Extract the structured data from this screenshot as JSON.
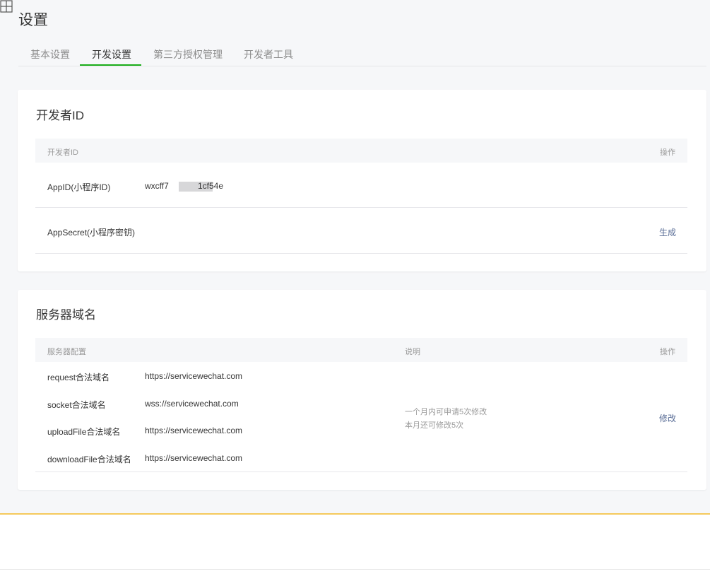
{
  "page": {
    "title": "设置"
  },
  "tabs": [
    {
      "label": "基本设置",
      "active": false
    },
    {
      "label": "开发设置",
      "active": true
    },
    {
      "label": "第三方授权管理",
      "active": false
    },
    {
      "label": "开发者工具",
      "active": false
    }
  ],
  "developer_id": {
    "title": "开发者ID",
    "col_name": "开发者ID",
    "col_action": "操作",
    "rows": [
      {
        "label": "AppID(小程序ID)",
        "value_prefix": "wxcff7",
        "value_suffix": "1cf54e",
        "action": ""
      },
      {
        "label": "AppSecret(小程序密钥)",
        "value": "",
        "action": "生成"
      }
    ]
  },
  "server_domain": {
    "title": "服务器域名",
    "col_config": "服务器配置",
    "col_desc": "说明",
    "col_action": "操作",
    "rows": [
      {
        "label": "request合法域名",
        "value": "https://servicewechat.com"
      },
      {
        "label": "socket合法域名",
        "value": "wss://servicewechat.com"
      },
      {
        "label": "uploadFile合法域名",
        "value": "https://servicewechat.com"
      },
      {
        "label": "downloadFile合法域名",
        "value": "https://servicewechat.com"
      }
    ],
    "desc_line1": "一个月内可申请5次修改",
    "desc_line2": "本月还可修改5次",
    "action": "修改"
  },
  "colors": {
    "accent_green": "#1aad19",
    "link_blue": "#576b95",
    "highlight_yellow": "#f5c95c"
  }
}
